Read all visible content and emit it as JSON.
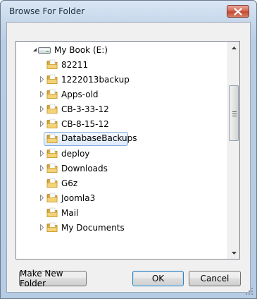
{
  "window": {
    "title": "Browse For Folder",
    "close_icon": "close-icon"
  },
  "tree": {
    "root": {
      "label": "My Book (E:)",
      "icon": "drive-icon",
      "expanded": true
    },
    "items": [
      {
        "label": "82211",
        "has_children": false,
        "selected": false
      },
      {
        "label": "1222013backup",
        "has_children": true,
        "selected": false
      },
      {
        "label": "Apps-old",
        "has_children": true,
        "selected": false
      },
      {
        "label": "CB-3-33-12",
        "has_children": true,
        "selected": false
      },
      {
        "label": "CB-8-15-12",
        "has_children": true,
        "selected": false
      },
      {
        "label": "DatabaseBackups",
        "has_children": false,
        "selected": true
      },
      {
        "label": "deploy",
        "has_children": true,
        "selected": false
      },
      {
        "label": "Downloads",
        "has_children": true,
        "selected": false
      },
      {
        "label": "G6z",
        "has_children": false,
        "selected": false
      },
      {
        "label": "Joomla3",
        "has_children": true,
        "selected": false
      },
      {
        "label": "Mail",
        "has_children": false,
        "selected": false
      },
      {
        "label": "My Documents",
        "has_children": true,
        "selected": false
      }
    ]
  },
  "buttons": {
    "make_new_folder": "Make New Folder",
    "ok": "OK",
    "cancel": "Cancel"
  },
  "colors": {
    "title_bar": "#c7d8ec",
    "close_button": "#c14a33",
    "selection": "#dbeafb",
    "folder": "#e8c35a"
  }
}
